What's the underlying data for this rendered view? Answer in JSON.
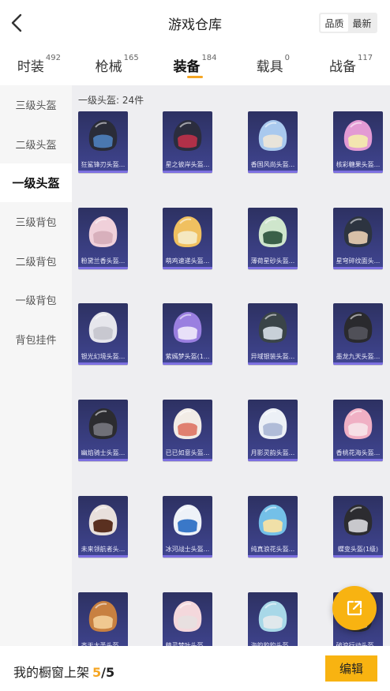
{
  "header": {
    "title": "游戏仓库",
    "back_icon": "chevron-left-icon"
  },
  "sort": {
    "options": [
      "品质",
      "最新"
    ],
    "active": "品质"
  },
  "tabs": [
    {
      "label": "时装",
      "count": "492",
      "active": false
    },
    {
      "label": "枪械",
      "count": "165",
      "active": false
    },
    {
      "label": "装备",
      "count": "184",
      "active": true
    },
    {
      "label": "载具",
      "count": "0",
      "active": false
    },
    {
      "label": "战备",
      "count": "117",
      "active": false
    }
  ],
  "sidebar": {
    "items": [
      {
        "label": "三级头盔",
        "active": false
      },
      {
        "label": "二级头盔",
        "active": false
      },
      {
        "label": "一级头盔",
        "active": true
      },
      {
        "label": "三级背包",
        "active": false
      },
      {
        "label": "二级背包",
        "active": false
      },
      {
        "label": "一级背包",
        "active": false
      },
      {
        "label": "背包挂件",
        "active": false
      }
    ]
  },
  "main": {
    "section_title": "一级头盔: 24件",
    "items": [
      {
        "label": "狂鲨锋刃头盔...",
        "color": "#2a2c38",
        "visor": "#4a78b0"
      },
      {
        "label": "星之彼岸头盔...",
        "color": "#2b2d3e",
        "visor": "#b03048"
      },
      {
        "label": "香国风尚头盔...",
        "color": "#a9c9ee",
        "visor": "#e8e4da"
      },
      {
        "label": "核彩糖果头盔...",
        "color": "#e39ad4",
        "visor": "#f3e5b0"
      },
      {
        "label": "粉黛兰香头盔...",
        "color": "#f0d0da",
        "visor": "#d8b0bc"
      },
      {
        "label": "萌鸡速递头盔...",
        "color": "#f0c060",
        "visor": "#f5e8c0"
      },
      {
        "label": "薄荷星砂头盔...",
        "color": "#cfe6cc",
        "visor": "#3a6048"
      },
      {
        "label": "星穹碎纹面头...",
        "color": "#2d3440",
        "visor": "#d8c0a8"
      },
      {
        "label": "银光幻境头盔...",
        "color": "#e6e6ec",
        "visor": "#c8c8d0"
      },
      {
        "label": "紫嫣梦头盔(1...",
        "color": "#9a7fe0",
        "visor": "#e8e0f8"
      },
      {
        "label": "异域银装头盔...",
        "color": "#3a4448",
        "visor": "#c8d0d8"
      },
      {
        "label": "墨龙九天头盔...",
        "color": "#2a2a2e",
        "visor": "#505058"
      },
      {
        "label": "幽焰骑士头盔...",
        "color": "#2c2c30",
        "visor": "#707078"
      },
      {
        "label": "已已如意头盔...",
        "color": "#f2ece6",
        "visor": "#e08070"
      },
      {
        "label": "月影灵韵头盔...",
        "color": "#ecf0f6",
        "visor": "#b0bcd8"
      },
      {
        "label": "香桃花海头盔...",
        "color": "#f0b0c4",
        "visor": "#f6e0e6"
      },
      {
        "label": "未来领航者头...",
        "color": "#e8e0dc",
        "visor": "#5a3020"
      },
      {
        "label": "冰河战士头盔...",
        "color": "#eef2f8",
        "visor": "#3a78c8"
      },
      {
        "label": "纯真浪花头盔...",
        "color": "#74c0e8",
        "visor": "#f0e0a8"
      },
      {
        "label": "蝶变头盔(1级)",
        "color": "#2c2c30",
        "visor": "#c8c8cc"
      },
      {
        "label": "齐天大圣头盔...",
        "color": "#c88040",
        "visor": "#f0c890"
      },
      {
        "label": "精灵梦叶头盔...",
        "color": "#f4d8dc",
        "visor": "#e8e0e0"
      },
      {
        "label": "海韵豹豹头盔...",
        "color": "#a8d8e8",
        "visor": "#e0e8ec"
      },
      {
        "label": "破浪行动头盔...",
        "color": "#2c2c30",
        "visor": "#d8d0c0"
      }
    ]
  },
  "fab": {
    "icon": "share-external-icon"
  },
  "bottom": {
    "shelf_label": "我的橱窗上架",
    "current": "5",
    "separator": "/",
    "total": "5",
    "edit_label": "编辑"
  },
  "colors": {
    "accent": "#f8b311",
    "card_top": "#2d3162",
    "card_bottom": "#404591"
  }
}
